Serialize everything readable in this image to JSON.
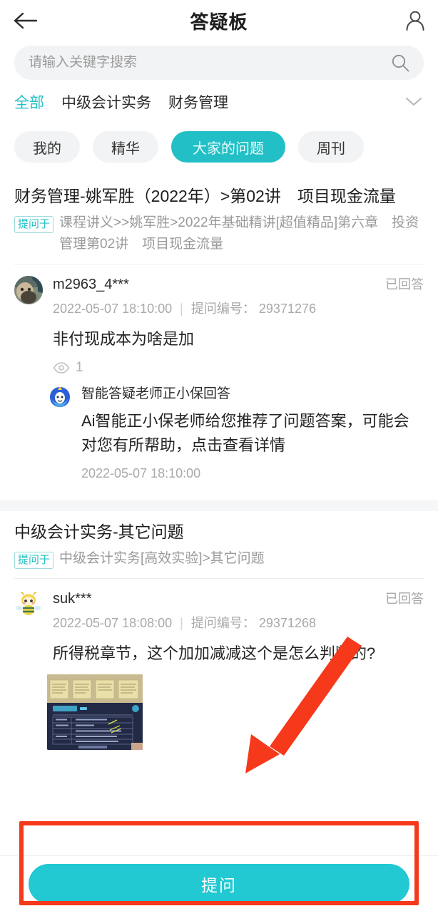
{
  "header": {
    "title": "答疑板",
    "back_icon": "arrow-left-icon",
    "user_icon": "person-icon"
  },
  "search": {
    "placeholder": "请输入关键字搜索",
    "value": "",
    "icon": "search-icon"
  },
  "categories": {
    "items": [
      {
        "label": "全部",
        "active": true
      },
      {
        "label": "中级会计实务",
        "active": false
      },
      {
        "label": "财务管理",
        "active": false
      }
    ],
    "expand_icon": "chevron-down-icon"
  },
  "filters": [
    {
      "label": "我的",
      "active": false
    },
    {
      "label": "精华",
      "active": false
    },
    {
      "label": "大家的问题",
      "active": true
    },
    {
      "label": "周刊",
      "active": false
    }
  ],
  "posts": [
    {
      "title": "财务管理-姚军胜（2022年）>第02讲　项目现金流量",
      "crumb_tag": "提问于",
      "crumb_text": "课程讲义>>姚军胜>2022年基础精讲[超值精品]第六章　投资管理第02讲　项目现金流量",
      "user": "m2963_4***",
      "status": "已回答",
      "time": "2022-05-07 18:10:00",
      "id_label": "提问编号：",
      "id_value": "29371276",
      "question": "非付现成本为啥是加",
      "views_icon": "eye-icon",
      "views": "1",
      "answer": {
        "avatar_icon": "ai-bot-avatar",
        "name": "智能答疑老师正小保回答",
        "text": "Ai智能正小保老师给您推荐了问题答案，可能会对您有所帮助，点击查看详情",
        "time": "2022-05-07 18:10:00"
      }
    },
    {
      "title": "中级会计实务-其它问题",
      "crumb_tag": "提问于",
      "crumb_text": "中级会计实务[高效实验]>其它问题",
      "user": "suk***",
      "status": "已回答",
      "time": "2022-05-07 18:08:00",
      "id_label": "提问编号：",
      "id_value": "29371268",
      "question": "所得税章节，这个加加减减这个是怎么判断的?",
      "attachment_icon": "image-thumbnail"
    }
  ],
  "bottom": {
    "ask_label": "提问"
  },
  "colors": {
    "accent": "#22c0c6",
    "button": "#22c8d2",
    "annotation": "#f5391a",
    "search_bg": "#f2f3f5",
    "chip_bg": "#f2f3f5",
    "muted_text": "#a9a9a9"
  }
}
